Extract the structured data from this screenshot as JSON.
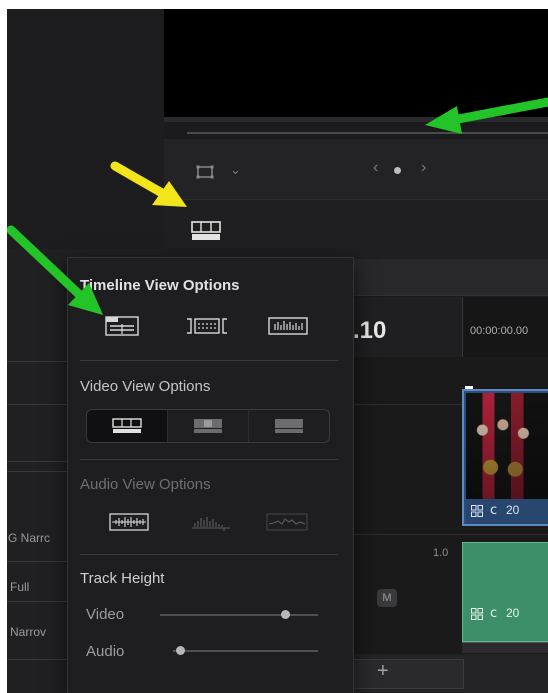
{
  "popup": {
    "timeline_view_title": "Timeline View Options",
    "video_view_title": "Video View Options",
    "audio_view_title": "Audio View Options",
    "track_height_title": "Track Height",
    "track_height_video_label": "Video",
    "track_height_audio_label": "Audio",
    "track_height_video_level": 0.79,
    "track_height_audio_level": 0.05
  },
  "viewer": {
    "nav_prev": "‹",
    "nav_next": "›",
    "zoom_chevron": "⌄"
  },
  "timeline": {
    "timecode_partial": ".10",
    "ruler_timecode": "00:00:00.00",
    "clip_label_video": "20",
    "clip_label_audio": "20",
    "audio_gain": "1.0",
    "mute_label": "M",
    "add_track_label": "+"
  },
  "left_panel": {
    "items": [
      "G Narrc",
      "Full",
      "Narrov"
    ]
  },
  "annotations": {
    "yellow_arrow_color": "#f2e51a",
    "green_arrow_color": "#22c427"
  },
  "colors": {
    "video_clip": "#2c4d77",
    "audio_clip": "#3d8f69",
    "popup_bg": "#1e1e20"
  }
}
